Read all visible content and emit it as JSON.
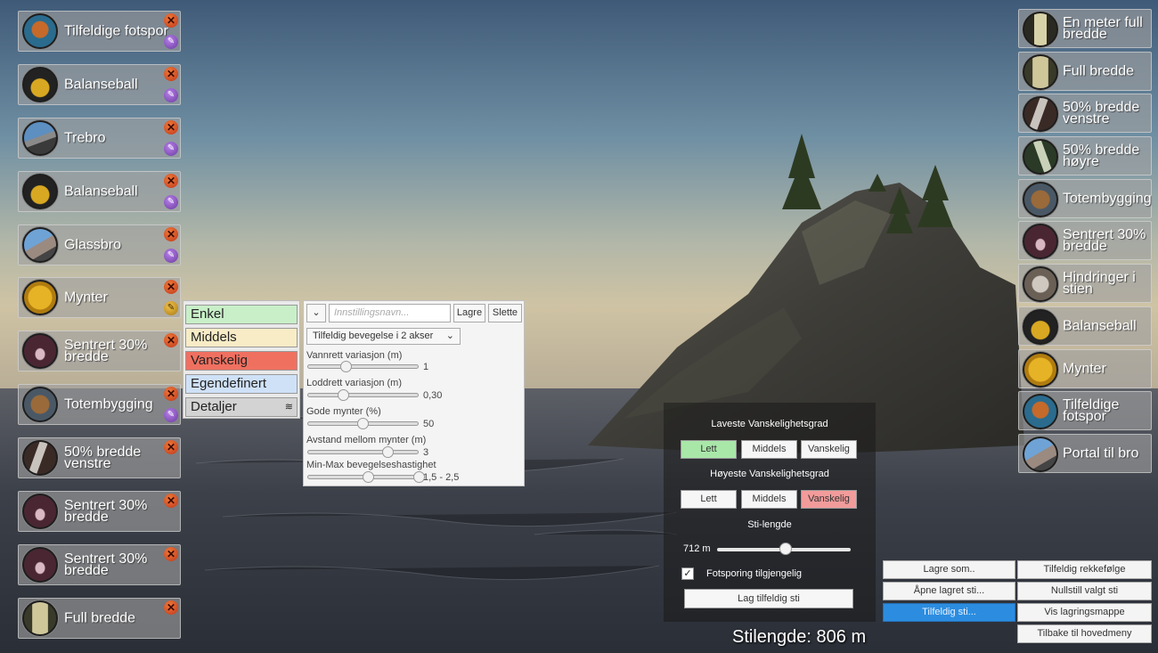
{
  "left_items": [
    {
      "label": "Tilfeldige fotspor",
      "thumb": "footprints-thumb",
      "edit_icon": "wrench-icon"
    },
    {
      "label": "Balanseball",
      "thumb": "balance-ball-thumb",
      "edit_icon": "wrench-icon"
    },
    {
      "label": "Trebro",
      "thumb": "wood-bridge-thumb",
      "edit_icon": "wrench-icon"
    },
    {
      "label": "Balanseball",
      "thumb": "balance-ball-thumb",
      "edit_icon": "wrench-icon"
    },
    {
      "label": "Glassbro",
      "thumb": "glass-bridge-thumb",
      "edit_icon": "wrench-icon"
    },
    {
      "label": "Mynter",
      "thumb": "coins-thumb",
      "edit_icon": "wrench-icon-active"
    },
    {
      "label": "Sentrert 30% bredde",
      "thumb": "centered-path-thumb",
      "edit_icon": ""
    },
    {
      "label": "Totembygging",
      "thumb": "totem-thumb",
      "edit_icon": "wrench-icon"
    },
    {
      "label": "50% bredde venstre",
      "thumb": "left-path-thumb",
      "edit_icon": ""
    },
    {
      "label": "Sentrert 30% bredde",
      "thumb": "centered-path-thumb",
      "edit_icon": ""
    },
    {
      "label": "Sentrert 30% bredde",
      "thumb": "centered-path-thumb",
      "edit_icon": ""
    },
    {
      "label": "Full bredde",
      "thumb": "full-path-thumb",
      "edit_icon": ""
    }
  ],
  "right_items": [
    {
      "label": "En meter full bredde",
      "thumb": "meter-path-thumb"
    },
    {
      "label": "Full bredde",
      "thumb": "full-path-thumb"
    },
    {
      "label": "50% bredde venstre",
      "thumb": "left-path-thumb"
    },
    {
      "label": "50% bredde høyre",
      "thumb": "right-path-thumb"
    },
    {
      "label": "Totembygging",
      "thumb": "totem-thumb"
    },
    {
      "label": "Sentrert 30% bredde",
      "thumb": "centered-path-thumb"
    },
    {
      "label": "Hindringer i stien",
      "thumb": "obstacles-thumb"
    },
    {
      "label": "Balanseball",
      "thumb": "balance-ball-thumb"
    },
    {
      "label": "Mynter",
      "thumb": "coins-thumb"
    },
    {
      "label": "Tilfeldige fotspor",
      "thumb": "footprints-thumb"
    },
    {
      "label": "Portal til bro",
      "thumb": "portal-bridge-thumb"
    }
  ],
  "difficulty": {
    "easy": "Enkel",
    "medium": "Middels",
    "hard": "Vanskelig",
    "custom": "Egendefinert",
    "details": "Detaljer",
    "colors": {
      "easy": "#c8efc8",
      "medium": "#f7ecc6",
      "hard": "#f07060",
      "custom": "#cfe1f7",
      "details": "#d3d3d3"
    }
  },
  "settings": {
    "dropdown_icon": "chevron-down-icon",
    "name_placeholder": "Innstillingsnavn...",
    "save": "Lagre",
    "delete": "Slette",
    "movement_select": "Tilfeldig bevegelse i 2 akser",
    "sliders": [
      {
        "label": "Vannrett variasjon (m)",
        "value_text": "1",
        "fraction": 0.35
      },
      {
        "label": "Loddrett variasjon (m)",
        "value_text": "0,30",
        "fraction": 0.32
      },
      {
        "label": "Gode mynter (%)",
        "value_text": "50",
        "fraction": 0.5
      },
      {
        "label": "Avstand mellom mynter (m)",
        "value_text": "3",
        "fraction": 0.72
      }
    ],
    "range": {
      "label": "Min-Max bevegelseshastighet",
      "value_text": "1,5 - 2,5",
      "low": 0.55,
      "high": 1.0
    }
  },
  "random_panel": {
    "lowest_title": "Laveste Vanskelighetsgrad",
    "highest_title": "Høyeste Vanskelighetsgrad",
    "easy": "Lett",
    "medium": "Middels",
    "hard": "Vanskelig",
    "length_title": "Sti-lengde",
    "length_value": "712 m",
    "length_fraction": 0.51,
    "footprints_label": "Fotsporing tilgjengelig",
    "footprints_checked": true,
    "make_random": "Lag tilfeldig sti"
  },
  "bottom_buttons": {
    "save_as": "Lagre som..",
    "open_saved": "Åpne lagret sti...",
    "random_path": "Tilfeldig sti...",
    "random_order": "Tilfeldig rekkefølge",
    "reset_selected": "Nullstill valgt sti",
    "show_folder": "Vis lagringsmappe",
    "back_main": "Tilbake til hovedmeny"
  },
  "path_length_text": "Stilengde: 806 m"
}
